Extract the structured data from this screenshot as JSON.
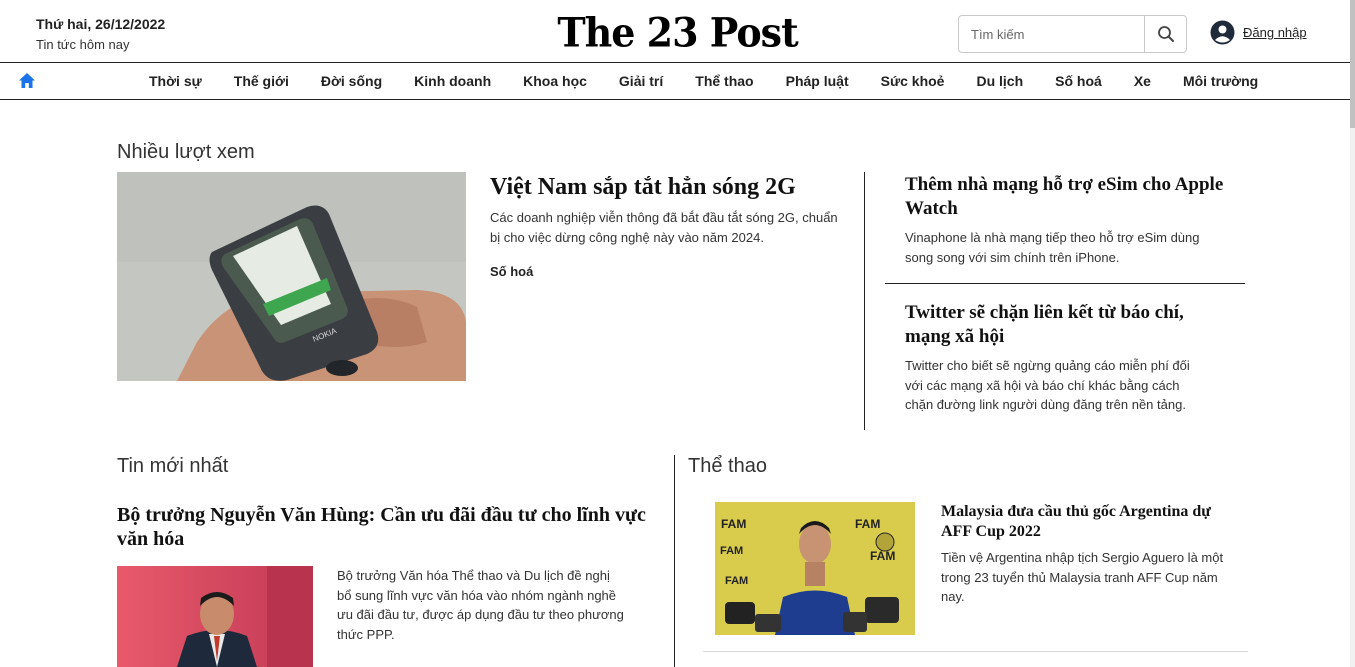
{
  "header": {
    "date": "Thứ hai, 26/12/2022",
    "tagline": "Tin tức hôm nay",
    "logo": "The 23 Post",
    "search_placeholder": "Tìm kiếm",
    "login_label": "Đăng nhập"
  },
  "nav": {
    "items": [
      "Thời sự",
      "Thế giới",
      "Đời sống",
      "Kinh doanh",
      "Khoa học",
      "Giải trí",
      "Thể thao",
      "Pháp luật",
      "Sức khoẻ",
      "Du lịch",
      "Số hoá",
      "Xe",
      "Môi trường"
    ]
  },
  "most_viewed": {
    "title": "Nhiều lượt xem",
    "main": {
      "headline": "Việt Nam sắp tắt hẳn sóng 2G",
      "summary": "Các doanh nghiệp viễn thông đã bắt đầu tắt sóng 2G, chuẩn bị cho việc dừng công nghệ này vào năm 2024.",
      "category": "Số hoá"
    },
    "side": [
      {
        "headline": "Thêm nhà mạng hỗ trợ eSim cho Apple Watch",
        "summary": "Vinaphone là nhà mạng tiếp theo hỗ trợ eSim dùng song song với sim chính trên iPhone."
      },
      {
        "headline": "Twitter sẽ chặn liên kết từ báo chí, mạng xã hội",
        "summary": "Twitter cho biết sẽ ngừng quảng cáo miễn phí đối với các mạng xã hội và báo chí khác bằng cách chặn đường link người dùng đăng trên nền tảng."
      }
    ]
  },
  "latest": {
    "title": "Tin mới nhất",
    "headline": "Bộ trưởng Nguyễn Văn Hùng: Cần ưu đãi đầu tư cho lĩnh vực văn hóa",
    "summary": "Bộ trưởng Văn hóa Thể thao và Du lịch đề nghị bổ sung lĩnh vực văn hóa vào nhóm ngành nghề ưu đãi đầu tư, được áp dụng đầu tư theo phương thức PPP."
  },
  "sports": {
    "title": "Thể thao",
    "headline": "Malaysia đưa cầu thủ gốc Argentina dự AFF Cup 2022",
    "summary": "Tiền vệ Argentina nhập tịch Sergio Aguero là một trong 23 tuyển thủ Malaysia tranh AFF Cup năm nay.",
    "image_text": "FAM"
  },
  "phone_image_text": "NOKIA",
  "colors": {
    "home_icon": "#1a73e8",
    "rule": "#222222"
  }
}
